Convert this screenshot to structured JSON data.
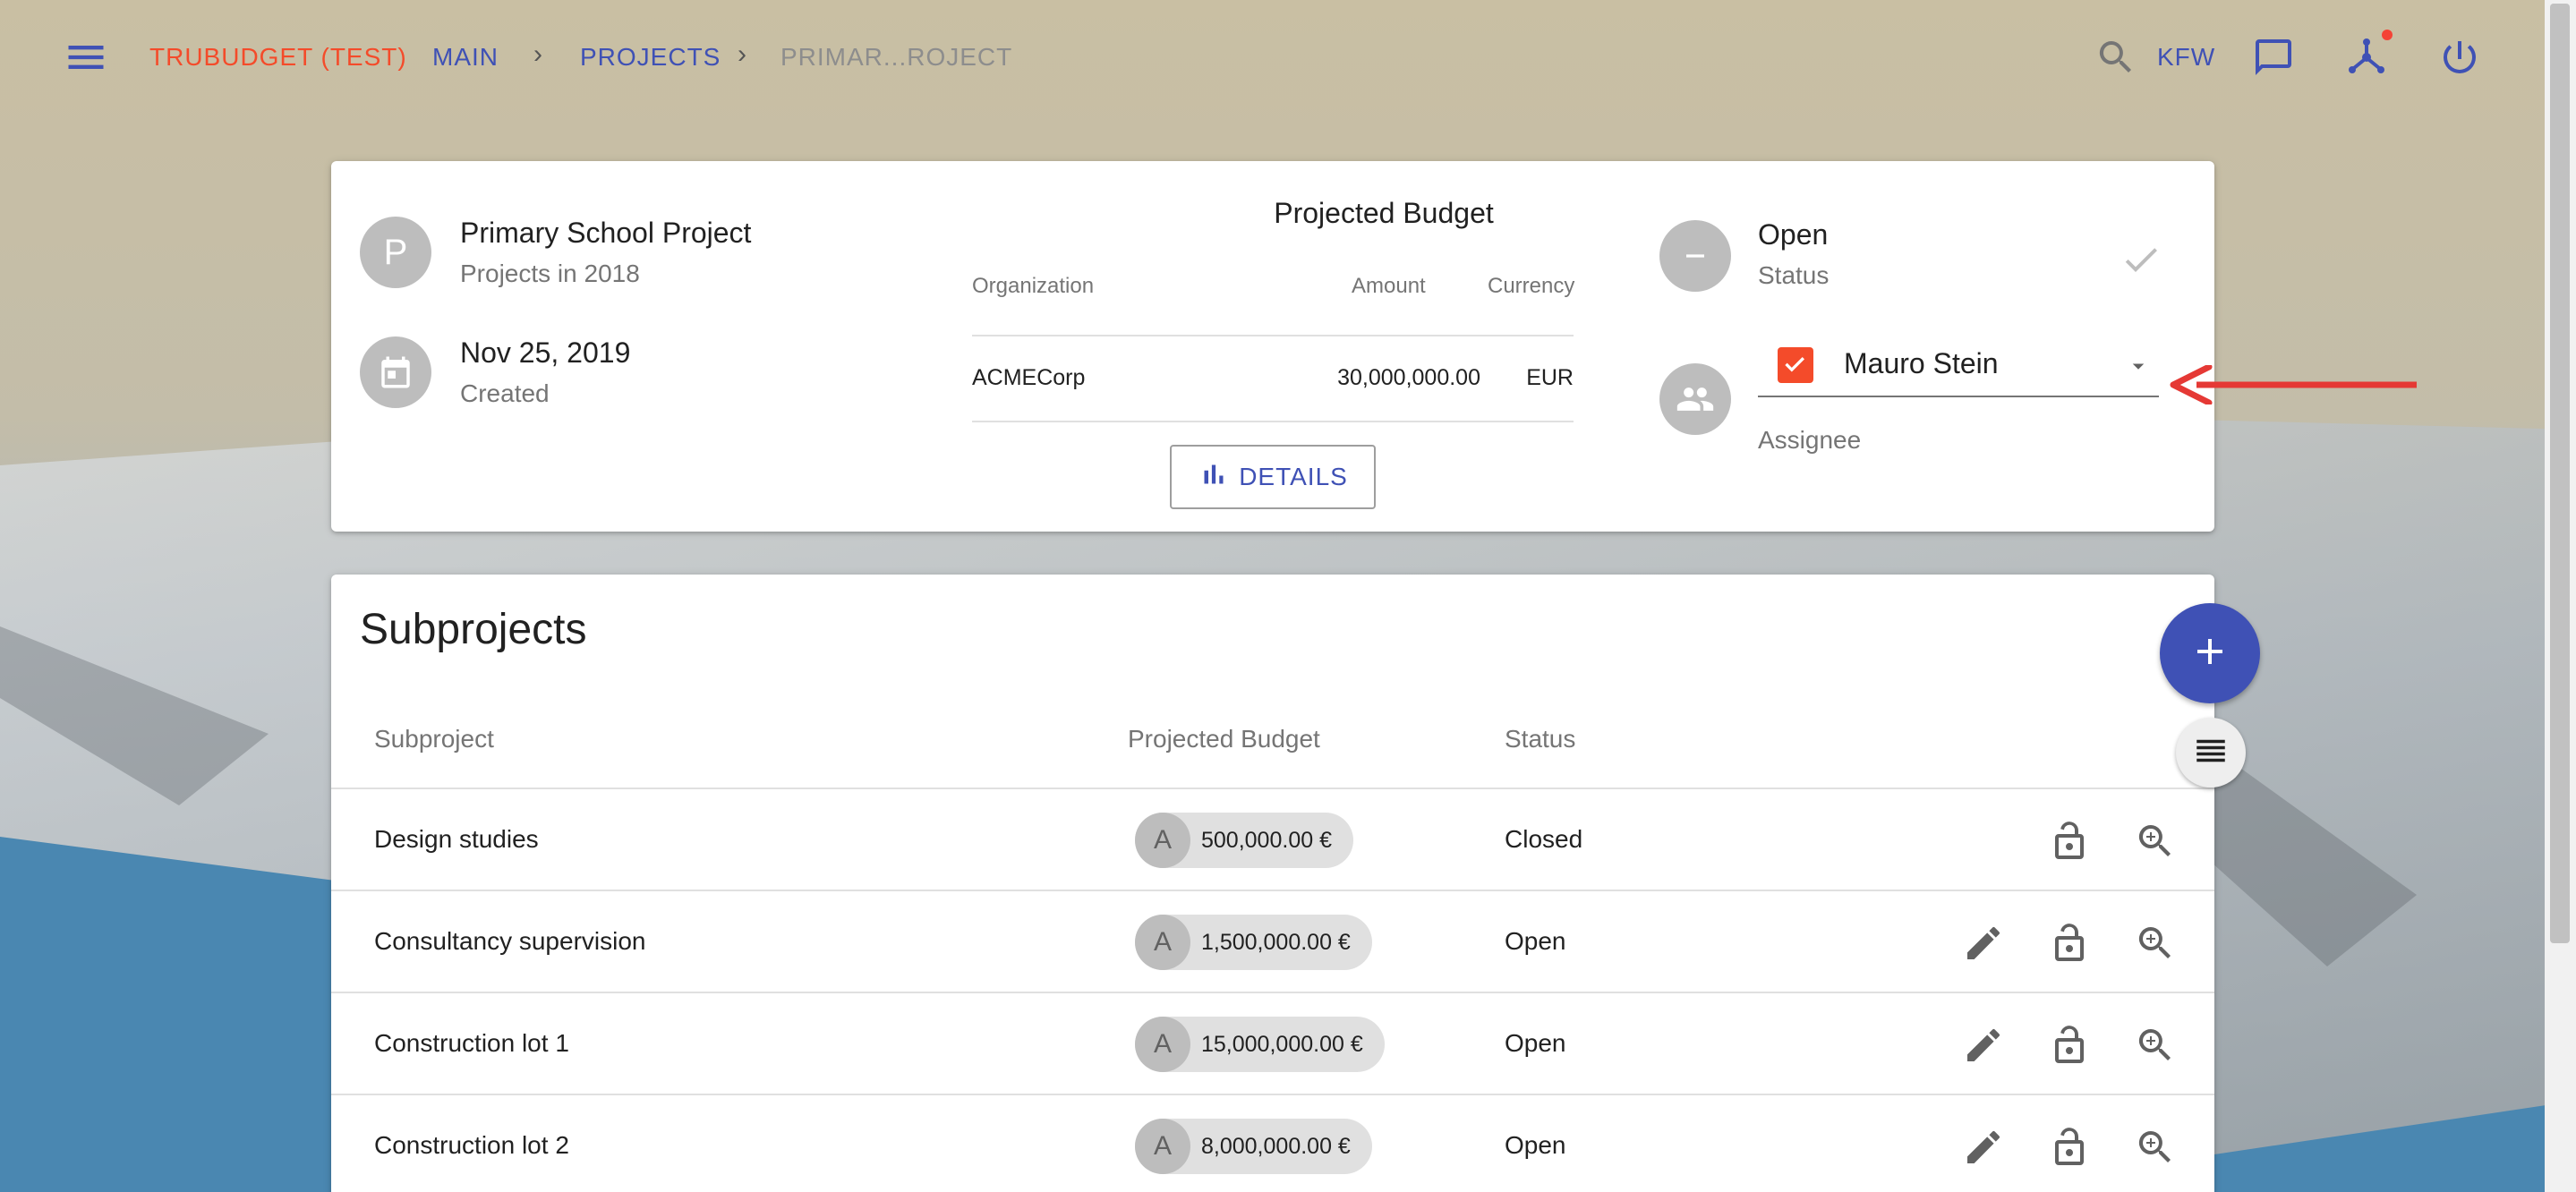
{
  "topbar": {
    "brand": "TRUBUDGET (TEST)",
    "breadcrumbs": [
      "MAIN",
      "PROJECTS",
      "PRIMAR...ROJECT"
    ],
    "separator": "›",
    "organization": "KFW",
    "accent_color": "#3f51b5",
    "brand_color": "#f44b2a"
  },
  "project": {
    "avatar_letter": "P",
    "name": "Primary School Project",
    "subtitle": "Projects in 2018",
    "created_date": "Nov 25, 2019",
    "created_label": "Created",
    "status_value": "Open",
    "status_label": "Status",
    "assignee_name": "Mauro Stein",
    "assignee_label": "Assignee"
  },
  "projected_budget": {
    "title": "Projected Budget",
    "headers": {
      "organization": "Organization",
      "amount": "Amount",
      "currency": "Currency"
    },
    "rows": [
      {
        "organization": "ACMECorp",
        "amount": "30,000,000.00",
        "currency": "EUR"
      }
    ],
    "details_button": "DETAILS"
  },
  "subprojects": {
    "title": "Subprojects",
    "headers": {
      "subproject": "Subproject",
      "budget": "Projected Budget",
      "status": "Status"
    },
    "rows": [
      {
        "name": "Design studies",
        "avatar": "A",
        "budget": "500,000.00 €",
        "status": "Closed",
        "editable": false
      },
      {
        "name": "Consultancy supervision",
        "avatar": "A",
        "budget": "1,500,000.00 €",
        "status": "Open",
        "editable": true
      },
      {
        "name": "Construction lot 1",
        "avatar": "A",
        "budget": "15,000,000.00 €",
        "status": "Open",
        "editable": true
      },
      {
        "name": "Construction lot 2",
        "avatar": "A",
        "budget": "8,000,000.00 €",
        "status": "Open",
        "editable": true
      }
    ]
  },
  "icons": {
    "menu": "menu-icon",
    "search": "search-icon",
    "messages": "chat-icon",
    "network": "network-icon",
    "logout": "power-icon",
    "calendar": "calendar-icon",
    "status": "minus-circle-icon",
    "done": "check-icon",
    "assignee": "people-icon",
    "details": "bar-chart-icon",
    "edit": "pencil-icon",
    "permissions": "lock-open-icon",
    "view": "zoom-in-icon",
    "add": "plus-icon",
    "list": "list-icon"
  }
}
